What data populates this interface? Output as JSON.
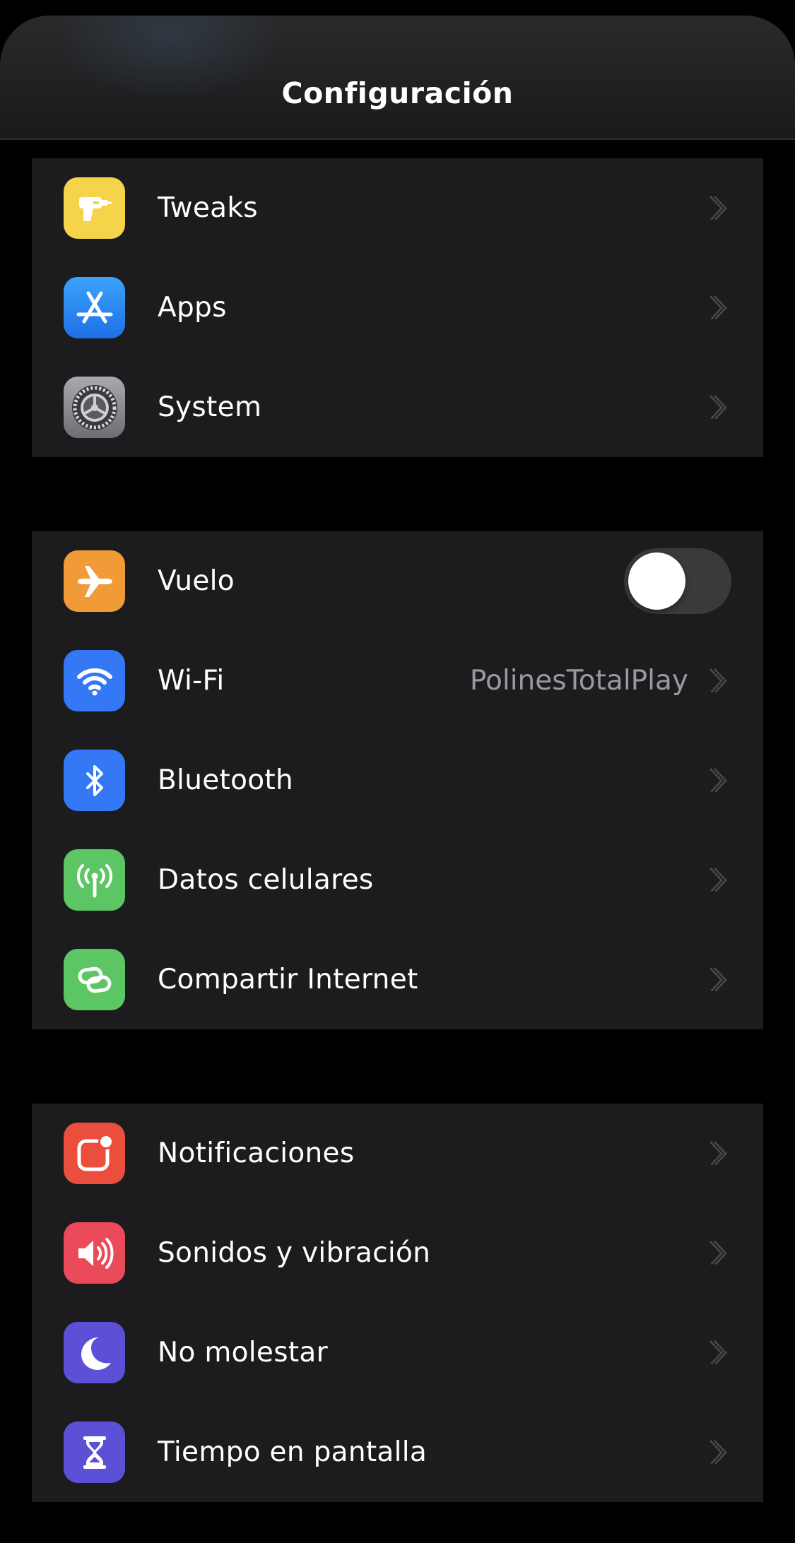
{
  "header": {
    "title": "Configuración"
  },
  "group1": {
    "items": [
      {
        "label": "Tweaks",
        "icon": "drill-icon",
        "color": "#f5d34b"
      },
      {
        "label": "Apps",
        "icon": "app-store-icon",
        "color": "#2f8cf5"
      },
      {
        "label": "System",
        "icon": "settings-gear-icon",
        "color": "#8e8e93"
      }
    ]
  },
  "group2": {
    "items": [
      {
        "label": "Vuelo",
        "icon": "airplane-icon",
        "color": "#f19a38",
        "toggle": false
      },
      {
        "label": "Wi-Fi",
        "icon": "wifi-icon",
        "color": "#3478f6",
        "value": "PolinesTotalPlay"
      },
      {
        "label": "Bluetooth",
        "icon": "bluetooth-icon",
        "color": "#3478f6"
      },
      {
        "label": "Datos celulares",
        "icon": "antenna-icon",
        "color": "#5cc564"
      },
      {
        "label": "Compartir Internet",
        "icon": "hotspot-link-icon",
        "color": "#5cc564"
      }
    ]
  },
  "group3": {
    "items": [
      {
        "label": "Notificaciones",
        "icon": "notifications-icon",
        "color": "#eb4e3d"
      },
      {
        "label": "Sonidos y vibración",
        "icon": "speaker-icon",
        "color": "#eb4a5a"
      },
      {
        "label": "No molestar",
        "icon": "moon-icon",
        "color": "#5b50d6"
      },
      {
        "label": "Tiempo en pantalla",
        "icon": "hourglass-icon",
        "color": "#5b50d6"
      }
    ]
  }
}
